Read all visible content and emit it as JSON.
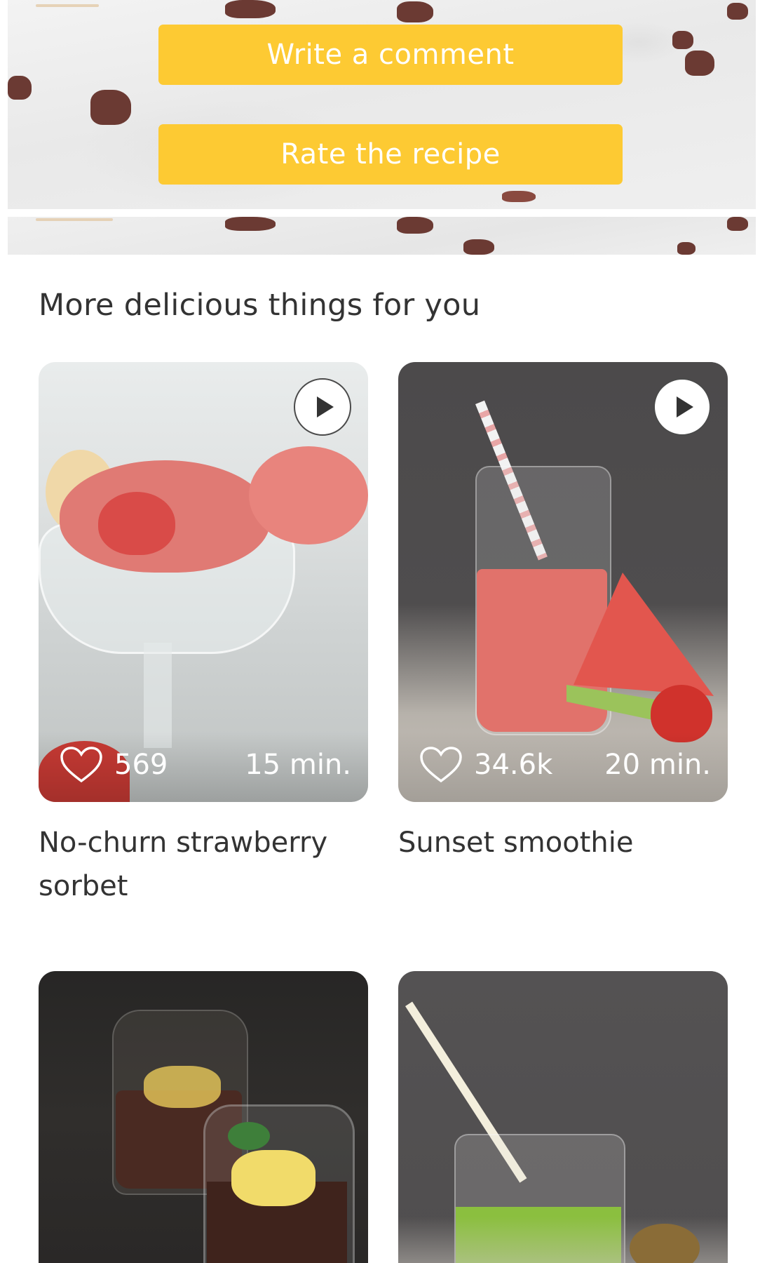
{
  "actions": {
    "write_comment_label": "Write a comment",
    "rate_recipe_label": "Rate the recipe"
  },
  "section": {
    "title": "More delicious things for you"
  },
  "recipes": [
    {
      "title": "No-churn strawberry sorbet",
      "likes": "569",
      "time": "15 min.",
      "has_video": true
    },
    {
      "title": "Sunset smoothie",
      "likes": "34.6k",
      "time": "20 min.",
      "has_video": true
    },
    {
      "title": "",
      "likes": "",
      "time": "",
      "has_video": false
    },
    {
      "title": "",
      "likes": "",
      "time": "",
      "has_video": false
    }
  ],
  "colors": {
    "accent": "#fdca33",
    "button_text": "#ffffff",
    "title_text": "#333333"
  },
  "icons": {
    "play": "play-icon",
    "heart": "heart-outline-icon"
  }
}
